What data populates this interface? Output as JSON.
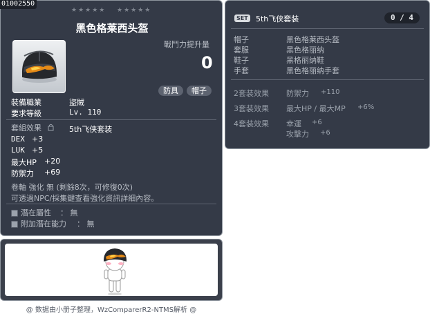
{
  "item": {
    "id": "01002550",
    "stars_left": "★★★★★",
    "stars_right": "★★★★★",
    "title": "黑色格莱西头盔",
    "power_label": "戰鬥力提升量",
    "power_value": "0",
    "tags": [
      "防具",
      "帽子"
    ],
    "job_label": "裝備職業",
    "job_value": "盜賊",
    "level_label": "要求等級",
    "level_value": "Lv. 110",
    "set_label": "套組效果",
    "set_value": "5th飞侠套装",
    "stats": [
      {
        "name": "DEX",
        "value": "+3"
      },
      {
        "name": "LUK",
        "value": "+5"
      },
      {
        "name": "最大HP",
        "value": "+20"
      },
      {
        "name": "防禦力",
        "value": "+69"
      }
    ],
    "scroll_text": "卷軸 強化 無 (剩餘8次，可修復0次)",
    "npc_text": "可透過NPC/採集鍵查看強化資訊詳細內容。",
    "potential_label": "潛在屬性",
    "potential_value": "： 無",
    "add_potential_label": "附加潛在能力",
    "add_potential_value": "： 無"
  },
  "set": {
    "badge": "SET",
    "name": "5th飞侠套装",
    "count": "0 / 4",
    "pieces": [
      {
        "slot": "帽子",
        "name": "黑色格莱西头盔"
      },
      {
        "slot": "套服",
        "name": "黑色格丽纳"
      },
      {
        "slot": "鞋子",
        "name": "黑格丽纳鞋"
      },
      {
        "slot": "手套",
        "name": "黑色格丽纳手套"
      }
    ],
    "effects": [
      {
        "label": "2套装效果",
        "stat": "防禦力",
        "value": "+110"
      },
      {
        "label": "3套装效果",
        "stat": "最大HP / 最大MP",
        "value": "+6%"
      },
      {
        "label": "4套装效果",
        "stat": "幸運",
        "value": "+6",
        "stat2": "攻擊力",
        "value2": "+6"
      }
    ]
  },
  "footer": "@ 数据由小册子整理，WzComparerR2-NTMS解析 @",
  "colors": {
    "panel": "#343a47",
    "border": "#8f969f"
  },
  "icons": [
    "helmet-icon",
    "set-badge-icon",
    "lock-icon",
    "potential-bullet-icon",
    "character-avatar"
  ]
}
